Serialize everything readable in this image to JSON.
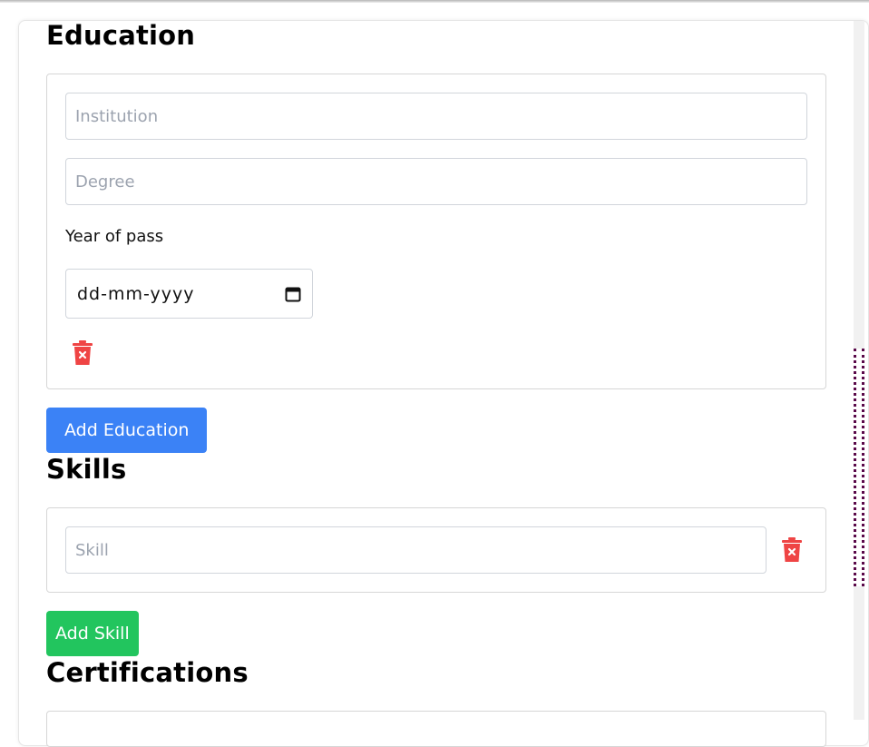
{
  "education": {
    "title": "Education",
    "institution_placeholder": "Institution",
    "degree_placeholder": "Degree",
    "year_label": "Year of pass",
    "date_placeholder": "dd-mm-yyyy",
    "add_button": "Add Education"
  },
  "skills": {
    "title": "Skills",
    "skill_placeholder": "Skill",
    "add_button": "Add Skill"
  },
  "certifications": {
    "title": "Certifications"
  },
  "colors": {
    "primary": "#3b82f6",
    "success": "#22c55e",
    "danger": "#ef4444"
  },
  "icons": [
    "trash-icon",
    "calendar-icon"
  ]
}
